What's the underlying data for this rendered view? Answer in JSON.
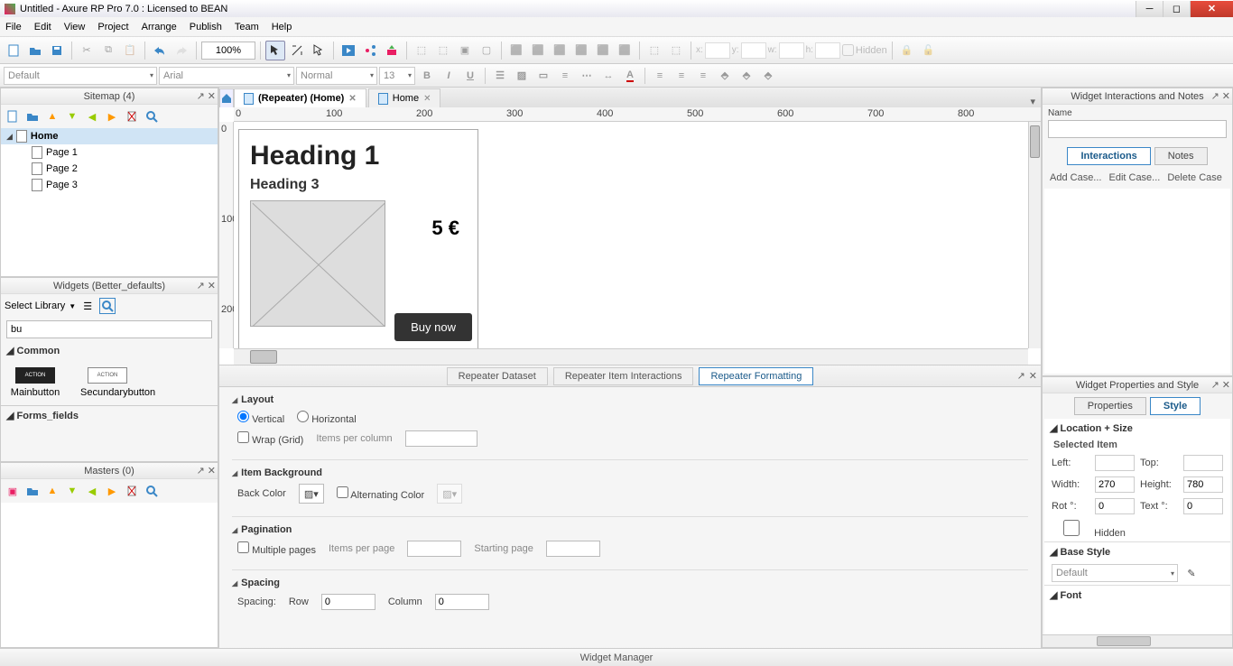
{
  "title": "Untitled - Axure RP Pro 7.0 : Licensed to BEAN",
  "menu": [
    "File",
    "Edit",
    "View",
    "Project",
    "Arrange",
    "Publish",
    "Team",
    "Help"
  ],
  "zoom": "100%",
  "format": {
    "style": "Default",
    "font": "Arial",
    "weight": "Normal",
    "size": "13"
  },
  "pos": {
    "hidden": "Hidden"
  },
  "sitemap": {
    "title": "Sitemap (4)",
    "root": "Home",
    "pages": [
      "Page 1",
      "Page 2",
      "Page 3"
    ]
  },
  "widgets": {
    "title": "Widgets (Better_defaults)",
    "selectlib": "Select Library",
    "search": "bu",
    "cat1": "Common",
    "items": [
      {
        "name": "Mainbutton",
        "thb": "ACTION"
      },
      {
        "name": "Secundarybutton",
        "thb": "ACTION"
      }
    ],
    "cat2": "Forms_fields"
  },
  "masters": {
    "title": "Masters (0)"
  },
  "tabs": [
    {
      "label": "(Repeater) (Home)",
      "active": true
    },
    {
      "label": "Home",
      "active": false
    }
  ],
  "ruler": [
    "0",
    "100",
    "200",
    "300",
    "400",
    "500",
    "600",
    "700",
    "800"
  ],
  "rulerv": [
    "0",
    "100",
    "200"
  ],
  "repeater": {
    "h1": "Heading 1",
    "h3": "Heading 3",
    "price": "5 €",
    "btn": "Buy now"
  },
  "bottom": {
    "tabs": [
      "Repeater Dataset",
      "Repeater Item Interactions",
      "Repeater Formatting"
    ],
    "active": 2,
    "layout": {
      "title": "Layout",
      "v": "Vertical",
      "h": "Horizontal",
      "wrap": "Wrap (Grid)",
      "ipc": "Items per column"
    },
    "itembg": {
      "title": "Item Background",
      "bc": "Back Color",
      "alt": "Alternating Color"
    },
    "pag": {
      "title": "Pagination",
      "mp": "Multiple pages",
      "ipp": "Items per page",
      "sp": "Starting page"
    },
    "spacing": {
      "title": "Spacing",
      "lbl": "Spacing:",
      "row": "Row",
      "rowv": "0",
      "col": "Column",
      "colv": "0"
    }
  },
  "interactions": {
    "title": "Widget Interactions and Notes",
    "name": "Name",
    "tabs": [
      "Interactions",
      "Notes"
    ],
    "links": [
      "Add Case...",
      "Edit Case...",
      "Delete Case"
    ]
  },
  "props": {
    "title": "Widget Properties and Style",
    "tabs": [
      "Properties",
      "Style"
    ],
    "locsize": "Location + Size",
    "selitem": "Selected Item",
    "left": "Left:",
    "top": "Top:",
    "width": "Width:",
    "widthv": "270",
    "height": "Height:",
    "heightv": "780",
    "rot": "Rot °:",
    "rotv": "0",
    "text": "Text °:",
    "textv": "0",
    "hidden": "Hidden",
    "basestyle": "Base Style",
    "bsval": "Default",
    "font": "Font"
  },
  "statusbar": "Widget Manager"
}
